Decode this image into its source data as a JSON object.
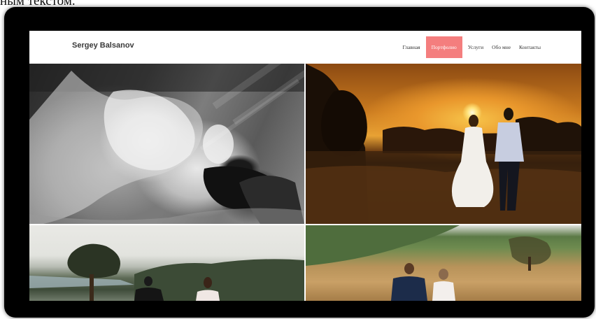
{
  "caption": "ным текстом.",
  "site": {
    "brand": "Sergey Balsanov",
    "menu": [
      {
        "label": "Главная",
        "active": false
      },
      {
        "label": "Портфолио",
        "active": true
      },
      {
        "label": "Услуги",
        "active": false
      },
      {
        "label": "Обо мне",
        "active": false
      },
      {
        "label": "Контакты",
        "active": false
      }
    ]
  },
  "colors": {
    "accent": "#f47e7e",
    "frame": "#000000"
  }
}
